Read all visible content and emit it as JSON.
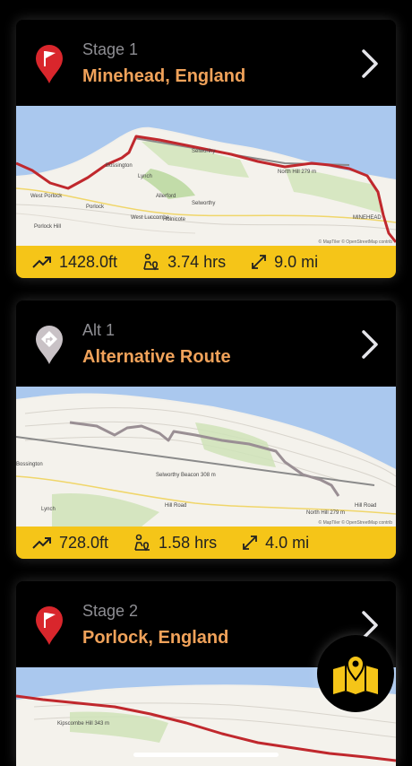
{
  "stages": [
    {
      "kicker": "Stage 1",
      "title": "Minehead, England",
      "icon": "red-flag-pin-icon",
      "map_labels": [
        "Bossington",
        "Selworthy",
        "Lynch",
        "Allerford",
        "Porlock",
        "West Porlock",
        "West Luccombe",
        "Holnicote",
        "Selworthy",
        "North Hill 279 m",
        "MINEHEAD",
        "Porlock Hill"
      ],
      "attribution": "© MapTiler © OpenStreetMap contrib",
      "stats": {
        "elevation": "1428.0ft",
        "duration": "3.74 hrs",
        "distance": "9.0 mi"
      }
    },
    {
      "kicker": "Alt 1",
      "title": "Alternative Route",
      "icon": "alt-route-pin-icon",
      "map_labels": [
        "Bossington",
        "Selworthy Beacon 308 m",
        "Lynch",
        "Hill Road",
        "North Hill 279 m",
        "Hill Road"
      ],
      "attribution": "© MapTiler © OpenStreetMap contrib",
      "stats": {
        "elevation": "728.0ft",
        "duration": "1.58 hrs",
        "distance": "4.0 mi"
      }
    },
    {
      "kicker": "Stage 2",
      "title": "Porlock, England",
      "icon": "red-flag-pin-icon",
      "map_labels": [
        "Kipscombe Hill 343 m"
      ]
    }
  ],
  "colors": {
    "accent": "#f0a25a",
    "stats_bar": "#f5c518",
    "route": "#c0282d",
    "alt_route": "#9a8f94"
  },
  "fab_icon": "map-pin-icon"
}
